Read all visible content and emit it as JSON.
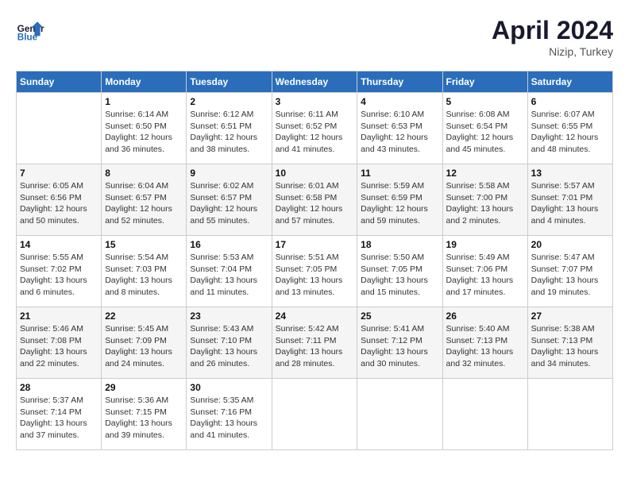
{
  "header": {
    "logo_line1": "General",
    "logo_line2": "Blue",
    "month_year": "April 2024",
    "location": "Nizip, Turkey"
  },
  "columns": [
    "Sunday",
    "Monday",
    "Tuesday",
    "Wednesday",
    "Thursday",
    "Friday",
    "Saturday"
  ],
  "weeks": [
    [
      {
        "day": "",
        "info": ""
      },
      {
        "day": "1",
        "info": "Sunrise: 6:14 AM\nSunset: 6:50 PM\nDaylight: 12 hours\nand 36 minutes."
      },
      {
        "day": "2",
        "info": "Sunrise: 6:12 AM\nSunset: 6:51 PM\nDaylight: 12 hours\nand 38 minutes."
      },
      {
        "day": "3",
        "info": "Sunrise: 6:11 AM\nSunset: 6:52 PM\nDaylight: 12 hours\nand 41 minutes."
      },
      {
        "day": "4",
        "info": "Sunrise: 6:10 AM\nSunset: 6:53 PM\nDaylight: 12 hours\nand 43 minutes."
      },
      {
        "day": "5",
        "info": "Sunrise: 6:08 AM\nSunset: 6:54 PM\nDaylight: 12 hours\nand 45 minutes."
      },
      {
        "day": "6",
        "info": "Sunrise: 6:07 AM\nSunset: 6:55 PM\nDaylight: 12 hours\nand 48 minutes."
      }
    ],
    [
      {
        "day": "7",
        "info": "Sunrise: 6:05 AM\nSunset: 6:56 PM\nDaylight: 12 hours\nand 50 minutes."
      },
      {
        "day": "8",
        "info": "Sunrise: 6:04 AM\nSunset: 6:57 PM\nDaylight: 12 hours\nand 52 minutes."
      },
      {
        "day": "9",
        "info": "Sunrise: 6:02 AM\nSunset: 6:57 PM\nDaylight: 12 hours\nand 55 minutes."
      },
      {
        "day": "10",
        "info": "Sunrise: 6:01 AM\nSunset: 6:58 PM\nDaylight: 12 hours\nand 57 minutes."
      },
      {
        "day": "11",
        "info": "Sunrise: 5:59 AM\nSunset: 6:59 PM\nDaylight: 12 hours\nand 59 minutes."
      },
      {
        "day": "12",
        "info": "Sunrise: 5:58 AM\nSunset: 7:00 PM\nDaylight: 13 hours\nand 2 minutes."
      },
      {
        "day": "13",
        "info": "Sunrise: 5:57 AM\nSunset: 7:01 PM\nDaylight: 13 hours\nand 4 minutes."
      }
    ],
    [
      {
        "day": "14",
        "info": "Sunrise: 5:55 AM\nSunset: 7:02 PM\nDaylight: 13 hours\nand 6 minutes."
      },
      {
        "day": "15",
        "info": "Sunrise: 5:54 AM\nSunset: 7:03 PM\nDaylight: 13 hours\nand 8 minutes."
      },
      {
        "day": "16",
        "info": "Sunrise: 5:53 AM\nSunset: 7:04 PM\nDaylight: 13 hours\nand 11 minutes."
      },
      {
        "day": "17",
        "info": "Sunrise: 5:51 AM\nSunset: 7:05 PM\nDaylight: 13 hours\nand 13 minutes."
      },
      {
        "day": "18",
        "info": "Sunrise: 5:50 AM\nSunset: 7:05 PM\nDaylight: 13 hours\nand 15 minutes."
      },
      {
        "day": "19",
        "info": "Sunrise: 5:49 AM\nSunset: 7:06 PM\nDaylight: 13 hours\nand 17 minutes."
      },
      {
        "day": "20",
        "info": "Sunrise: 5:47 AM\nSunset: 7:07 PM\nDaylight: 13 hours\nand 19 minutes."
      }
    ],
    [
      {
        "day": "21",
        "info": "Sunrise: 5:46 AM\nSunset: 7:08 PM\nDaylight: 13 hours\nand 22 minutes."
      },
      {
        "day": "22",
        "info": "Sunrise: 5:45 AM\nSunset: 7:09 PM\nDaylight: 13 hours\nand 24 minutes."
      },
      {
        "day": "23",
        "info": "Sunrise: 5:43 AM\nSunset: 7:10 PM\nDaylight: 13 hours\nand 26 minutes."
      },
      {
        "day": "24",
        "info": "Sunrise: 5:42 AM\nSunset: 7:11 PM\nDaylight: 13 hours\nand 28 minutes."
      },
      {
        "day": "25",
        "info": "Sunrise: 5:41 AM\nSunset: 7:12 PM\nDaylight: 13 hours\nand 30 minutes."
      },
      {
        "day": "26",
        "info": "Sunrise: 5:40 AM\nSunset: 7:13 PM\nDaylight: 13 hours\nand 32 minutes."
      },
      {
        "day": "27",
        "info": "Sunrise: 5:38 AM\nSunset: 7:13 PM\nDaylight: 13 hours\nand 34 minutes."
      }
    ],
    [
      {
        "day": "28",
        "info": "Sunrise: 5:37 AM\nSunset: 7:14 PM\nDaylight: 13 hours\nand 37 minutes."
      },
      {
        "day": "29",
        "info": "Sunrise: 5:36 AM\nSunset: 7:15 PM\nDaylight: 13 hours\nand 39 minutes."
      },
      {
        "day": "30",
        "info": "Sunrise: 5:35 AM\nSunset: 7:16 PM\nDaylight: 13 hours\nand 41 minutes."
      },
      {
        "day": "",
        "info": ""
      },
      {
        "day": "",
        "info": ""
      },
      {
        "day": "",
        "info": ""
      },
      {
        "day": "",
        "info": ""
      }
    ]
  ]
}
